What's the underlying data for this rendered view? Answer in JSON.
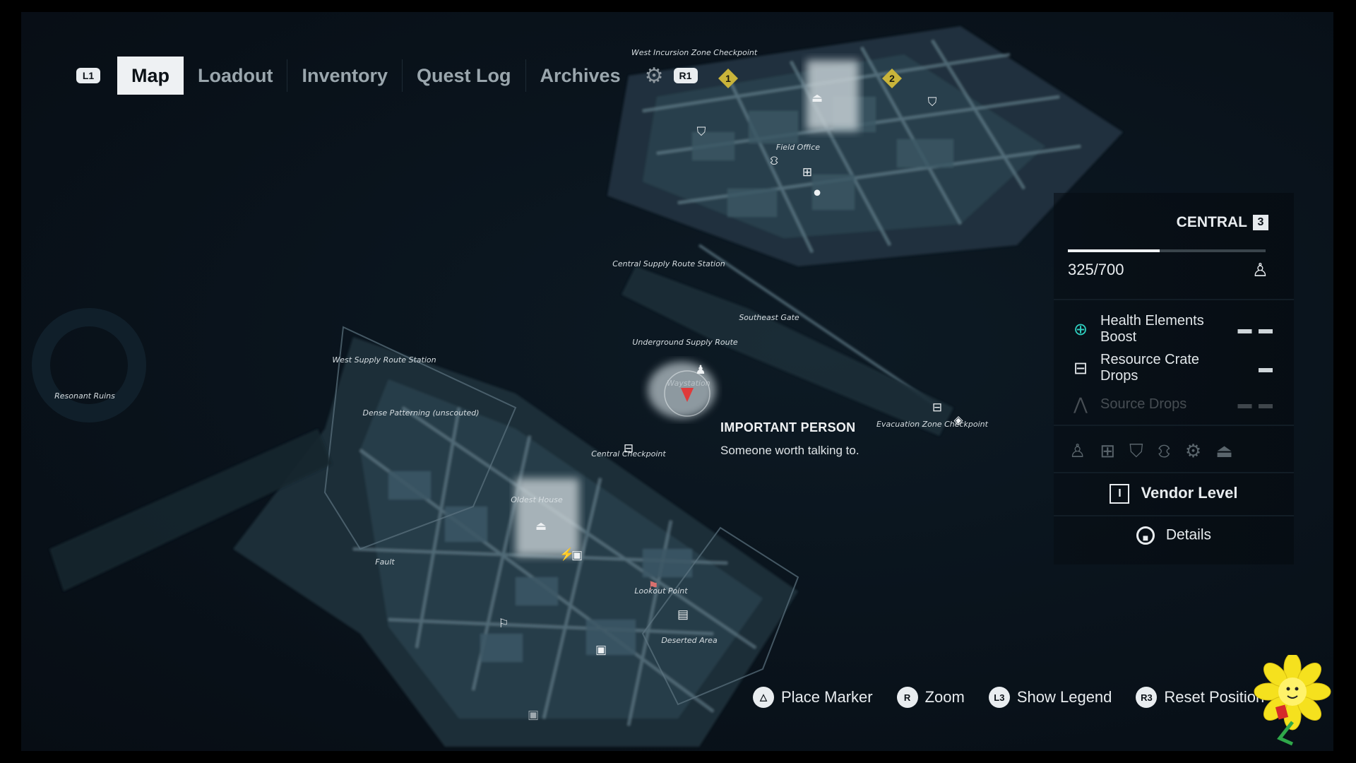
{
  "tabs": {
    "left_hint": "L1",
    "right_hint": "R1",
    "items": [
      {
        "label": "Map",
        "active": true
      },
      {
        "label": "Loadout",
        "active": false
      },
      {
        "label": "Inventory",
        "active": false
      },
      {
        "label": "Quest Log",
        "active": false
      },
      {
        "label": "Archives",
        "active": false
      }
    ],
    "settings_icon": "gear-icon"
  },
  "map": {
    "labels": {
      "west_incursion": "West Incursion Zone Checkpoint",
      "field_office": "Field Office",
      "central_supply": "Central Supply Route Station",
      "southeast_gate": "Southeast Gate",
      "underground_supply": "Underground Supply Route",
      "waystation": "Waystation",
      "west_supply": "West Supply Route Station",
      "dense_patterning": "Dense Patterning (unscouted)",
      "resonant_ruins": "Resonant Ruins",
      "central_checkpoint": "Central Checkpoint",
      "evacuation": "Evacuation Zone Checkpoint",
      "oldest_house": "Oldest House",
      "fault": "Fault",
      "lookout_point": "Lookout Point",
      "deserted_area": "Deserted Area"
    },
    "markers": {
      "objective_1": "1",
      "objective_2": "2"
    },
    "colors": {
      "objective": "#c9b43a",
      "player": "#e03a3a",
      "hazard": "#d9706e"
    }
  },
  "tooltip": {
    "title": "IMPORTANT PERSON",
    "description": "Someone worth talking to."
  },
  "panel": {
    "region": "CENTRAL",
    "region_level": "3",
    "xp_text": "325/700",
    "xp_progress": 0.464,
    "boosts": [
      {
        "label": "Health Elements Boost",
        "value": "▬ ▬",
        "icon": "health-plus-icon",
        "color": "#2fd0c0",
        "dim": false
      },
      {
        "label": "Resource Crate Drops",
        "value": "▬",
        "icon": "crate-icon",
        "color": "#e8ecef",
        "dim": false
      },
      {
        "label": "Source Drops",
        "value": "▬ ▬",
        "icon": "source-icon",
        "color": "#e8ecef",
        "dim": true
      }
    ],
    "filter_icons": [
      "person-icon",
      "map-icon",
      "shield-icon",
      "vendor-icon",
      "gear-icon",
      "coat-icon"
    ],
    "vendor_key": "I",
    "vendor_label": "Vendor Level",
    "details_label": "Details"
  },
  "hints": [
    {
      "key": "△",
      "label": "Place Marker"
    },
    {
      "key": "R",
      "label": "Zoom"
    },
    {
      "key": "L3",
      "label": "Show Legend"
    },
    {
      "key": "R3",
      "label": "Reset Position"
    }
  ]
}
